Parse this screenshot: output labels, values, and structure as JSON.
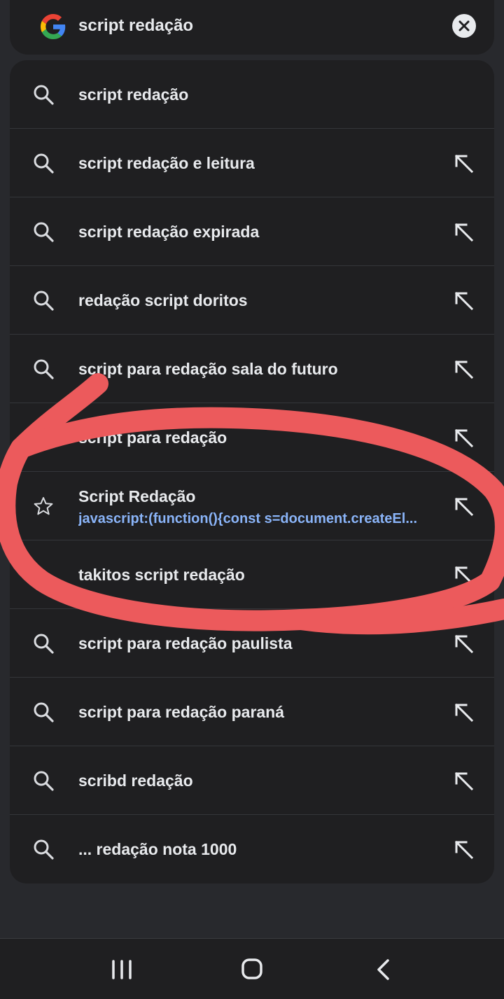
{
  "search": {
    "query": "script redação",
    "logo_icon": "google-g-icon",
    "clear_icon": "close-icon"
  },
  "suggestions": [
    {
      "text": "script redação",
      "icon": "search-icon",
      "fill": false
    },
    {
      "text": "script redação e leitura",
      "icon": "search-icon",
      "fill": true
    },
    {
      "text": "script redação expirada",
      "icon": "search-icon",
      "fill": true
    },
    {
      "text": "redação script doritos",
      "icon": "search-icon",
      "fill": true
    },
    {
      "text": "script para redação sala do futuro",
      "icon": "search-icon",
      "fill": true
    },
    {
      "text": "script para redação",
      "icon": "search-icon",
      "fill": true
    },
    {
      "text": "Script Redação",
      "url": "javascript:(function(){const s=document.createEl...",
      "icon": "star-icon",
      "fill": true
    },
    {
      "text": "takitos script redação",
      "icon": "none",
      "fill": true
    },
    {
      "text": "script para redação paulista",
      "icon": "search-icon",
      "fill": true
    },
    {
      "text": "script para redação paraná",
      "icon": "search-icon",
      "fill": true
    },
    {
      "text": "scribd redação",
      "icon": "search-icon",
      "fill": true
    },
    {
      "text": "... redação nota 1000",
      "icon": "search-icon",
      "fill": true
    }
  ],
  "navbar": {
    "recents_icon": "recent-apps-icon",
    "home_icon": "home-icon",
    "back_icon": "back-icon"
  },
  "colors": {
    "background": "#28292d",
    "card": "#1f1f21",
    "text": "#e8eaed",
    "link": "#8ab4f8",
    "annotation": "#ec5a5c"
  }
}
